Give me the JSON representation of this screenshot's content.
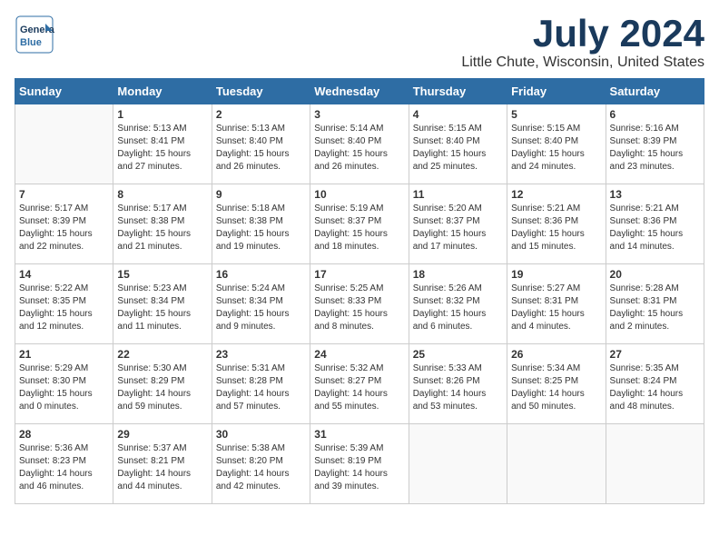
{
  "header": {
    "logo_line1": "General",
    "logo_line2": "Blue",
    "month": "July 2024",
    "location": "Little Chute, Wisconsin, United States"
  },
  "weekdays": [
    "Sunday",
    "Monday",
    "Tuesday",
    "Wednesday",
    "Thursday",
    "Friday",
    "Saturday"
  ],
  "weeks": [
    [
      {
        "day": "",
        "sunrise": "",
        "sunset": "",
        "daylight": ""
      },
      {
        "day": "1",
        "sunrise": "Sunrise: 5:13 AM",
        "sunset": "Sunset: 8:41 PM",
        "daylight": "Daylight: 15 hours and 27 minutes."
      },
      {
        "day": "2",
        "sunrise": "Sunrise: 5:13 AM",
        "sunset": "Sunset: 8:40 PM",
        "daylight": "Daylight: 15 hours and 26 minutes."
      },
      {
        "day": "3",
        "sunrise": "Sunrise: 5:14 AM",
        "sunset": "Sunset: 8:40 PM",
        "daylight": "Daylight: 15 hours and 26 minutes."
      },
      {
        "day": "4",
        "sunrise": "Sunrise: 5:15 AM",
        "sunset": "Sunset: 8:40 PM",
        "daylight": "Daylight: 15 hours and 25 minutes."
      },
      {
        "day": "5",
        "sunrise": "Sunrise: 5:15 AM",
        "sunset": "Sunset: 8:40 PM",
        "daylight": "Daylight: 15 hours and 24 minutes."
      },
      {
        "day": "6",
        "sunrise": "Sunrise: 5:16 AM",
        "sunset": "Sunset: 8:39 PM",
        "daylight": "Daylight: 15 hours and 23 minutes."
      }
    ],
    [
      {
        "day": "7",
        "sunrise": "Sunrise: 5:17 AM",
        "sunset": "Sunset: 8:39 PM",
        "daylight": "Daylight: 15 hours and 22 minutes."
      },
      {
        "day": "8",
        "sunrise": "Sunrise: 5:17 AM",
        "sunset": "Sunset: 8:38 PM",
        "daylight": "Daylight: 15 hours and 21 minutes."
      },
      {
        "day": "9",
        "sunrise": "Sunrise: 5:18 AM",
        "sunset": "Sunset: 8:38 PM",
        "daylight": "Daylight: 15 hours and 19 minutes."
      },
      {
        "day": "10",
        "sunrise": "Sunrise: 5:19 AM",
        "sunset": "Sunset: 8:37 PM",
        "daylight": "Daylight: 15 hours and 18 minutes."
      },
      {
        "day": "11",
        "sunrise": "Sunrise: 5:20 AM",
        "sunset": "Sunset: 8:37 PM",
        "daylight": "Daylight: 15 hours and 17 minutes."
      },
      {
        "day": "12",
        "sunrise": "Sunrise: 5:21 AM",
        "sunset": "Sunset: 8:36 PM",
        "daylight": "Daylight: 15 hours and 15 minutes."
      },
      {
        "day": "13",
        "sunrise": "Sunrise: 5:21 AM",
        "sunset": "Sunset: 8:36 PM",
        "daylight": "Daylight: 15 hours and 14 minutes."
      }
    ],
    [
      {
        "day": "14",
        "sunrise": "Sunrise: 5:22 AM",
        "sunset": "Sunset: 8:35 PM",
        "daylight": "Daylight: 15 hours and 12 minutes."
      },
      {
        "day": "15",
        "sunrise": "Sunrise: 5:23 AM",
        "sunset": "Sunset: 8:34 PM",
        "daylight": "Daylight: 15 hours and 11 minutes."
      },
      {
        "day": "16",
        "sunrise": "Sunrise: 5:24 AM",
        "sunset": "Sunset: 8:34 PM",
        "daylight": "Daylight: 15 hours and 9 minutes."
      },
      {
        "day": "17",
        "sunrise": "Sunrise: 5:25 AM",
        "sunset": "Sunset: 8:33 PM",
        "daylight": "Daylight: 15 hours and 8 minutes."
      },
      {
        "day": "18",
        "sunrise": "Sunrise: 5:26 AM",
        "sunset": "Sunset: 8:32 PM",
        "daylight": "Daylight: 15 hours and 6 minutes."
      },
      {
        "day": "19",
        "sunrise": "Sunrise: 5:27 AM",
        "sunset": "Sunset: 8:31 PM",
        "daylight": "Daylight: 15 hours and 4 minutes."
      },
      {
        "day": "20",
        "sunrise": "Sunrise: 5:28 AM",
        "sunset": "Sunset: 8:31 PM",
        "daylight": "Daylight: 15 hours and 2 minutes."
      }
    ],
    [
      {
        "day": "21",
        "sunrise": "Sunrise: 5:29 AM",
        "sunset": "Sunset: 8:30 PM",
        "daylight": "Daylight: 15 hours and 0 minutes."
      },
      {
        "day": "22",
        "sunrise": "Sunrise: 5:30 AM",
        "sunset": "Sunset: 8:29 PM",
        "daylight": "Daylight: 14 hours and 59 minutes."
      },
      {
        "day": "23",
        "sunrise": "Sunrise: 5:31 AM",
        "sunset": "Sunset: 8:28 PM",
        "daylight": "Daylight: 14 hours and 57 minutes."
      },
      {
        "day": "24",
        "sunrise": "Sunrise: 5:32 AM",
        "sunset": "Sunset: 8:27 PM",
        "daylight": "Daylight: 14 hours and 55 minutes."
      },
      {
        "day": "25",
        "sunrise": "Sunrise: 5:33 AM",
        "sunset": "Sunset: 8:26 PM",
        "daylight": "Daylight: 14 hours and 53 minutes."
      },
      {
        "day": "26",
        "sunrise": "Sunrise: 5:34 AM",
        "sunset": "Sunset: 8:25 PM",
        "daylight": "Daylight: 14 hours and 50 minutes."
      },
      {
        "day": "27",
        "sunrise": "Sunrise: 5:35 AM",
        "sunset": "Sunset: 8:24 PM",
        "daylight": "Daylight: 14 hours and 48 minutes."
      }
    ],
    [
      {
        "day": "28",
        "sunrise": "Sunrise: 5:36 AM",
        "sunset": "Sunset: 8:23 PM",
        "daylight": "Daylight: 14 hours and 46 minutes."
      },
      {
        "day": "29",
        "sunrise": "Sunrise: 5:37 AM",
        "sunset": "Sunset: 8:21 PM",
        "daylight": "Daylight: 14 hours and 44 minutes."
      },
      {
        "day": "30",
        "sunrise": "Sunrise: 5:38 AM",
        "sunset": "Sunset: 8:20 PM",
        "daylight": "Daylight: 14 hours and 42 minutes."
      },
      {
        "day": "31",
        "sunrise": "Sunrise: 5:39 AM",
        "sunset": "Sunset: 8:19 PM",
        "daylight": "Daylight: 14 hours and 39 minutes."
      },
      {
        "day": "",
        "sunrise": "",
        "sunset": "",
        "daylight": ""
      },
      {
        "day": "",
        "sunrise": "",
        "sunset": "",
        "daylight": ""
      },
      {
        "day": "",
        "sunrise": "",
        "sunset": "",
        "daylight": ""
      }
    ]
  ]
}
